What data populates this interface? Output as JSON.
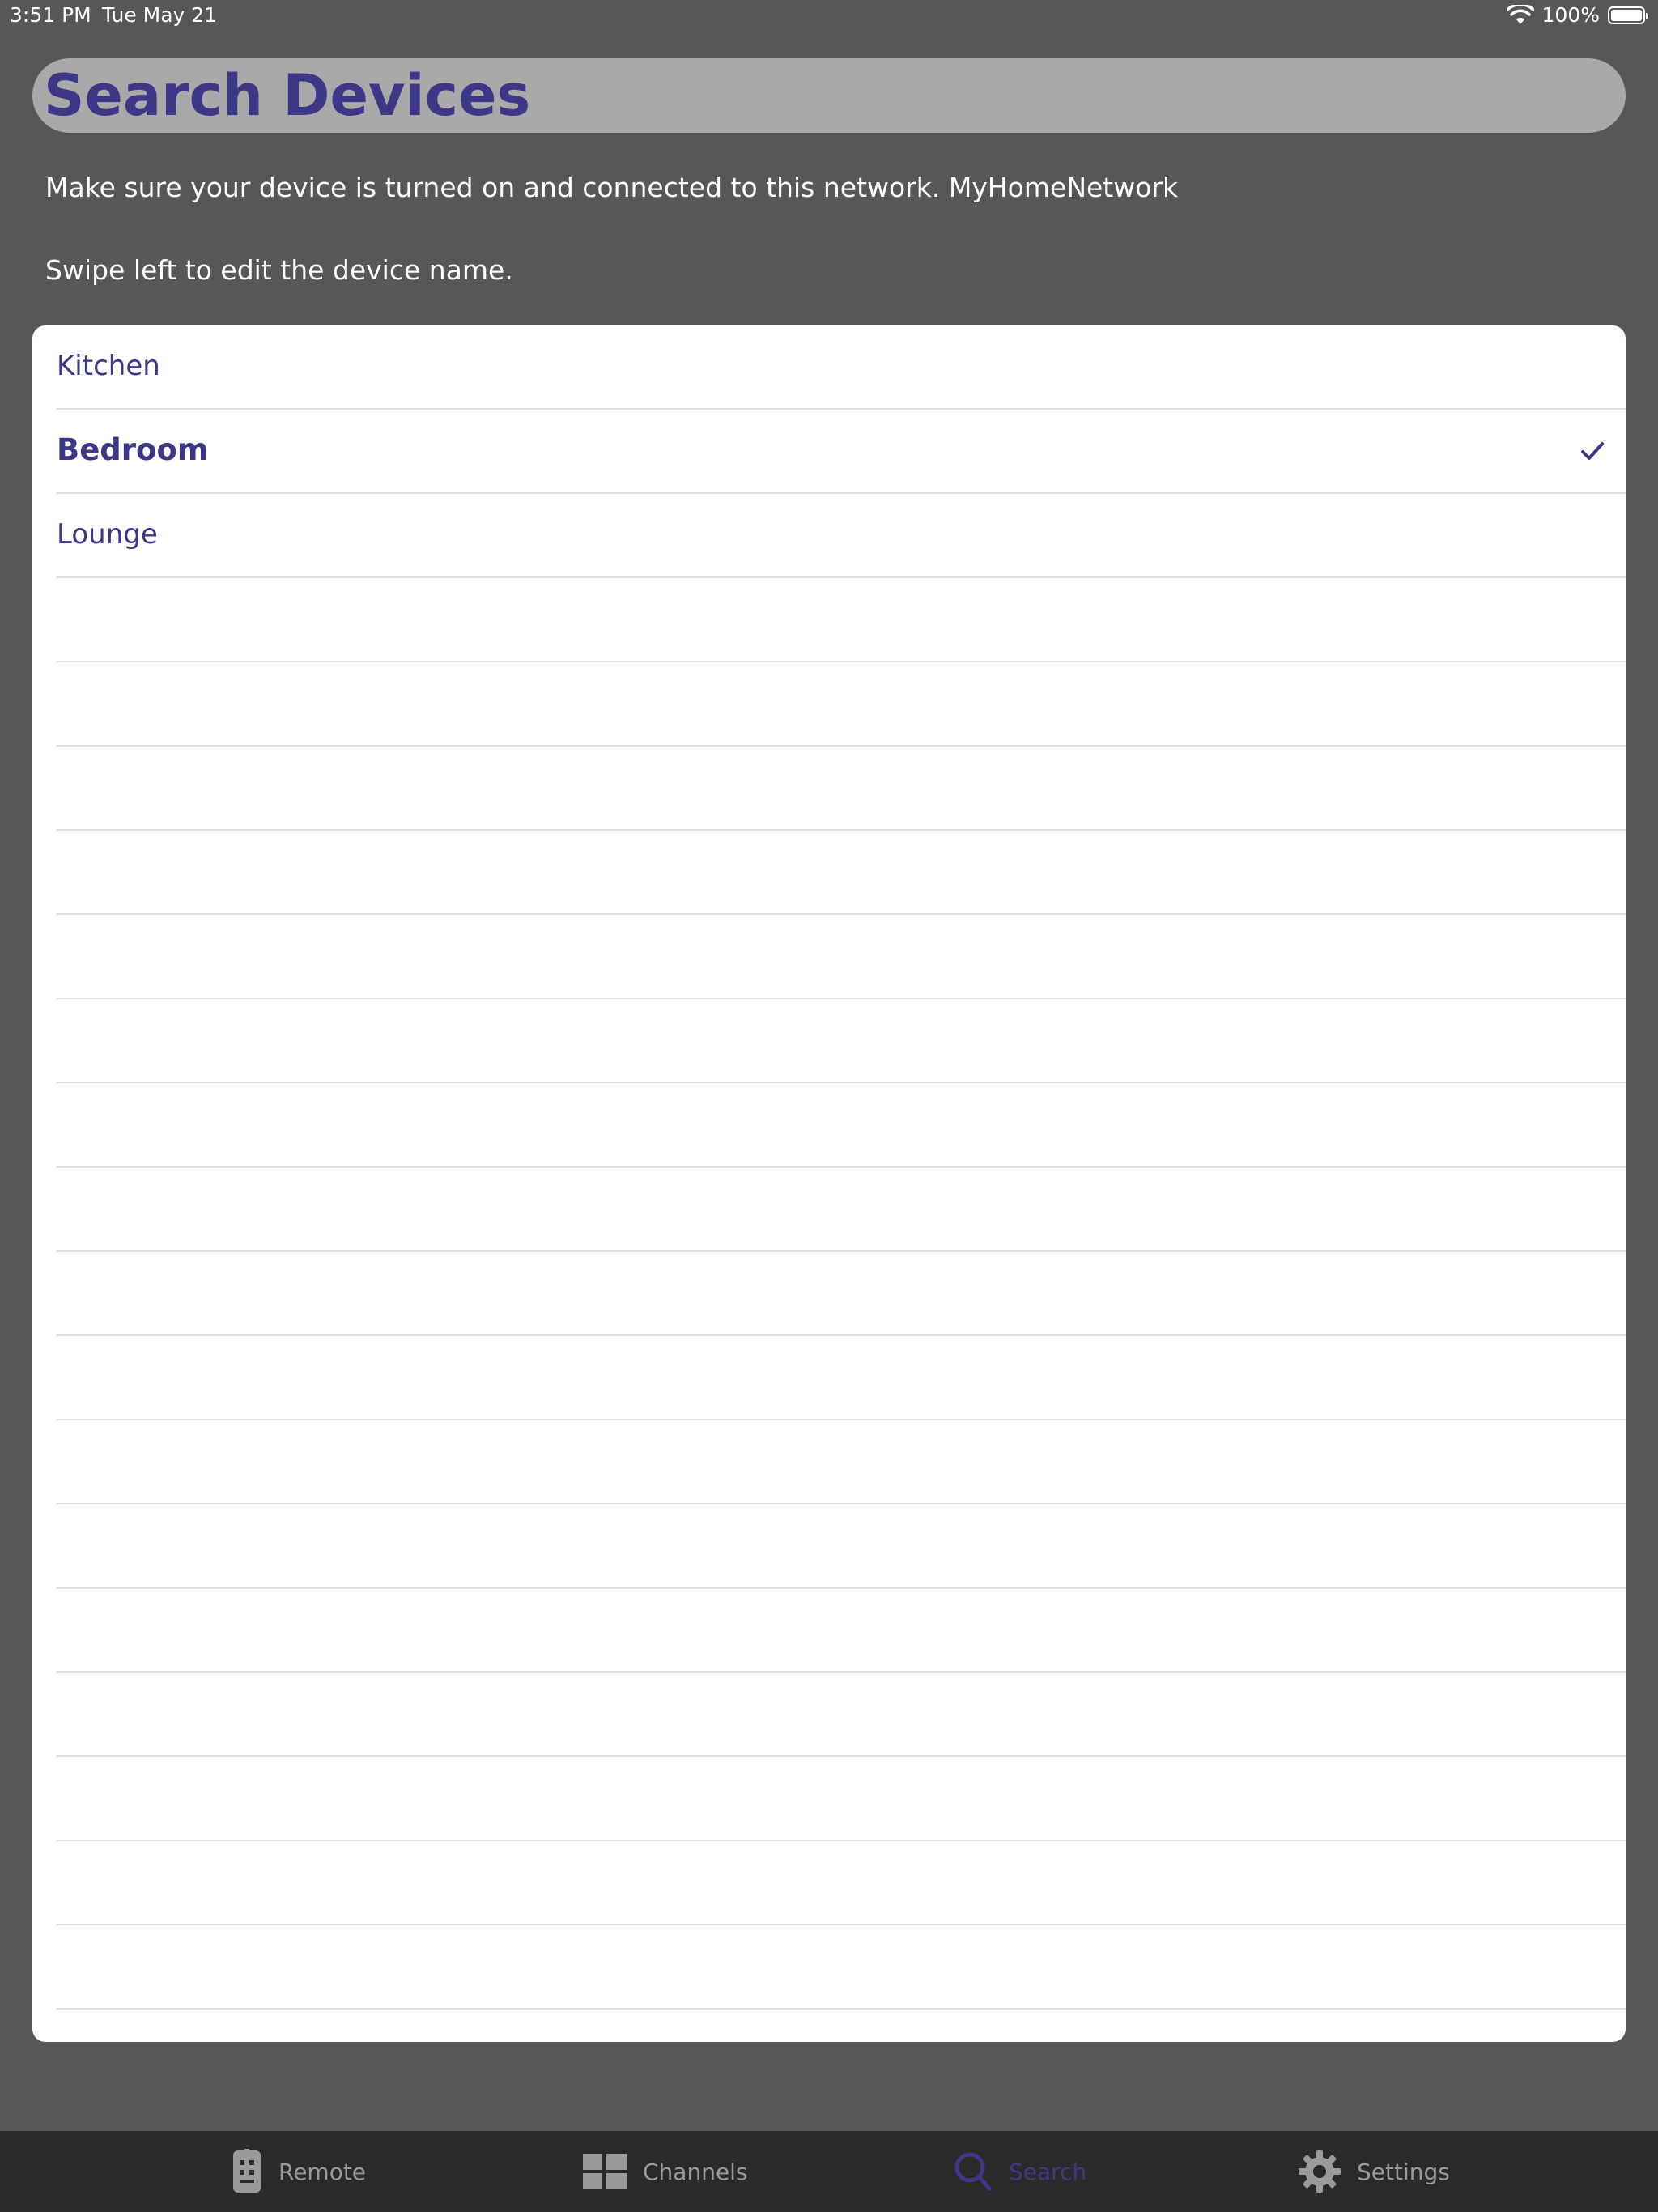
{
  "status_bar": {
    "time": "3:51 PM",
    "date": "Tue May 21",
    "battery": "100%"
  },
  "header": {
    "title": "Search Devices"
  },
  "info": {
    "network_message": "Make sure your device is turned on and connected to this network. MyHomeNetwork",
    "swipe_hint": "Swipe left to edit the device name."
  },
  "devices": {
    "items": [
      {
        "label": "Kitchen",
        "selected": false
      },
      {
        "label": "Bedroom",
        "selected": true
      },
      {
        "label": "Lounge",
        "selected": false
      }
    ]
  },
  "tabs": [
    {
      "label": "Remote",
      "icon": "remote-icon",
      "active": false
    },
    {
      "label": "Channels",
      "icon": "grid-icon",
      "active": false
    },
    {
      "label": "Search",
      "icon": "search-icon",
      "active": true
    },
    {
      "label": "Settings",
      "icon": "gear-icon",
      "active": false
    }
  ],
  "colors": {
    "accent": "#3d3787",
    "background": "#575757",
    "tabbar": "#2a2a2a"
  }
}
